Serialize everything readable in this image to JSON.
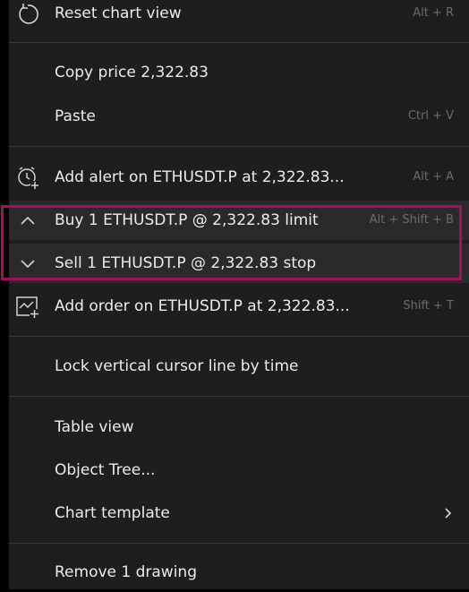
{
  "menu": {
    "items": [
      {
        "label": "Reset chart view",
        "shortcut": "Alt + R",
        "icon": "reset-icon"
      },
      {
        "label": "Copy price 2,322.83",
        "shortcut": ""
      },
      {
        "label": "Paste",
        "shortcut": "Ctrl + V"
      },
      {
        "label": "Add alert on ETHUSDT.P at 2,322.83...",
        "shortcut": "Alt + A",
        "icon": "alarm-clock-plus-icon"
      },
      {
        "label": "Buy 1 ETHUSDT.P @ 2,322.83 limit",
        "shortcut": "Alt + Shift + B",
        "icon": "chevron-up-icon"
      },
      {
        "label": "Sell 1 ETHUSDT.P @ 2,322.83 stop",
        "shortcut": "",
        "icon": "chevron-down-icon"
      },
      {
        "label": "Add order on ETHUSDT.P at 2,322.83...",
        "shortcut": "Shift + T",
        "icon": "chart-order-plus-icon"
      },
      {
        "label": "Lock vertical cursor line by time",
        "shortcut": ""
      },
      {
        "label": "Table view",
        "shortcut": ""
      },
      {
        "label": "Object Tree...",
        "shortcut": ""
      },
      {
        "label": "Chart template",
        "shortcut": "",
        "icon": "chevron-right-icon"
      },
      {
        "label": "Remove 1 drawing",
        "shortcut": ""
      }
    ]
  },
  "colors": {
    "background": "#1e1e1e",
    "text": "#ececec",
    "shortcut": "#6b6b6b",
    "separator": "#3a3a3a",
    "highlight_border": "#a3115e"
  }
}
